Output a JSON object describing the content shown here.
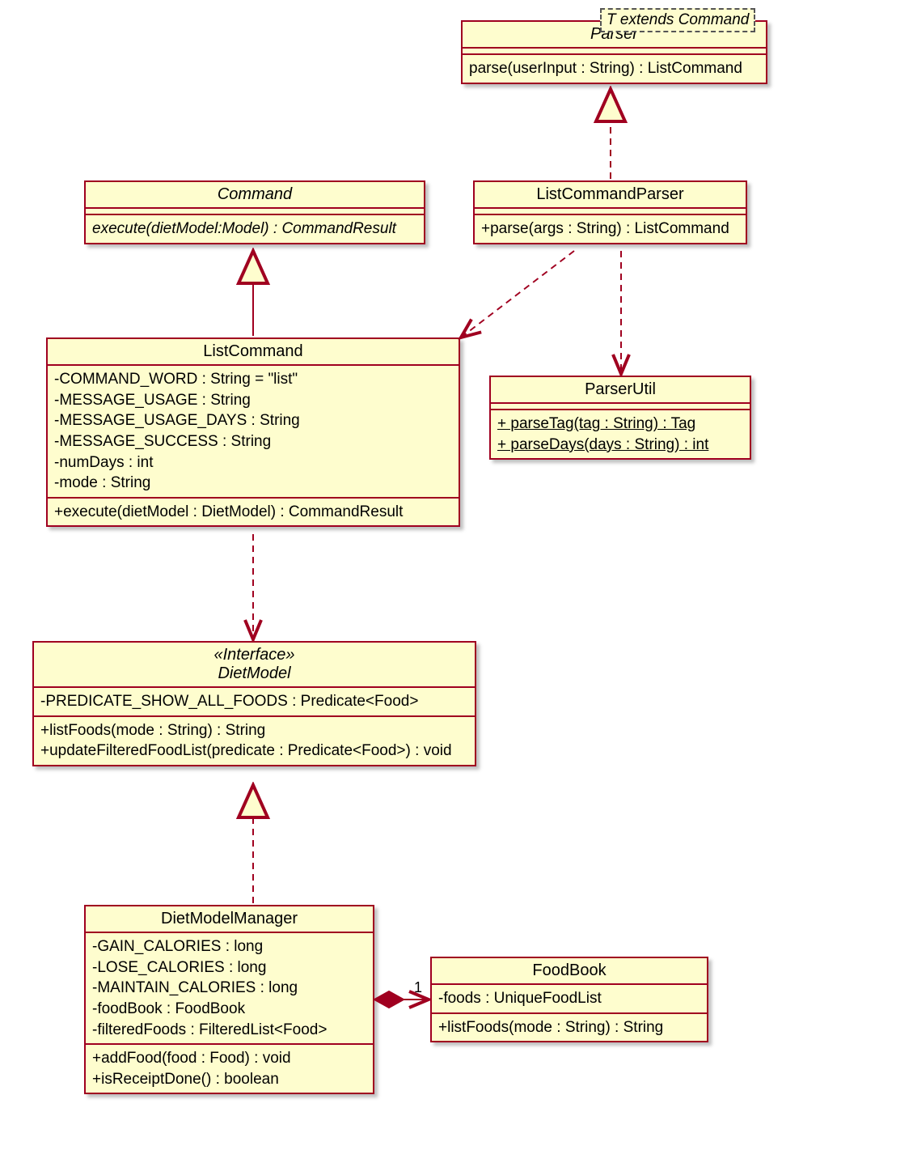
{
  "parser": {
    "title": "Parser",
    "method": "parse(userInput : String) : ListCommand",
    "generic": "T extends Command"
  },
  "command": {
    "title": "Command",
    "method": "execute(dietModel:Model) : CommandResult"
  },
  "listCommandParser": {
    "title": "ListCommandParser",
    "method": "+parse(args : String) : ListCommand"
  },
  "listCommand": {
    "title": "ListCommand",
    "attrs": [
      "-COMMAND_WORD : String = \"list\"",
      "-MESSAGE_USAGE : String",
      "-MESSAGE_USAGE_DAYS : String",
      "-MESSAGE_SUCCESS : String",
      "-numDays : int",
      "-mode : String"
    ],
    "method": "+execute(dietModel : DietModel) : CommandResult"
  },
  "parserUtil": {
    "title": "ParserUtil",
    "m1": "+ parseTag(tag : String) : Tag",
    "m2": "+ parseDays(days : String) : int"
  },
  "dietModel": {
    "stereotype": "«Interface»",
    "title": "DietModel",
    "attr": "-PREDICATE_SHOW_ALL_FOODS : Predicate<Food>",
    "m1": "+listFoods(mode : String) : String",
    "m2": "+updateFilteredFoodList(predicate : Predicate<Food>) : void"
  },
  "dietModelManager": {
    "title": "DietModelManager",
    "attrs": [
      "-GAIN_CALORIES : long",
      "-LOSE_CALORIES : long",
      "-MAINTAIN_CALORIES : long",
      "-foodBook : FoodBook",
      "-filteredFoods : FilteredList<Food>"
    ],
    "m1": "+addFood(food : Food) : void",
    "m2": "+isReceiptDone() : boolean"
  },
  "foodBook": {
    "title": "FoodBook",
    "attr": "-foods : UniqueFoodList",
    "method": "+listFoods(mode : String) : String"
  },
  "assoc": {
    "multiplicity": "1"
  },
  "chart_data": {
    "type": "uml-class-diagram",
    "classes": [
      {
        "name": "Parser",
        "stereotype": null,
        "generic": "T extends Command",
        "abstract": true,
        "attributes": [],
        "operations": [
          "parse(userInput : String) : ListCommand"
        ]
      },
      {
        "name": "Command",
        "abstract": true,
        "attributes": [],
        "operations": [
          "execute(dietModel:Model) : CommandResult"
        ]
      },
      {
        "name": "ListCommandParser",
        "attributes": [],
        "operations": [
          "+parse(args : String) : ListCommand"
        ]
      },
      {
        "name": "ListCommand",
        "attributes": [
          "-COMMAND_WORD : String = \"list\"",
          "-MESSAGE_USAGE : String",
          "-MESSAGE_USAGE_DAYS : String",
          "-MESSAGE_SUCCESS : String",
          "-numDays : int",
          "-mode : String"
        ],
        "operations": [
          "+execute(dietModel : DietModel) : CommandResult"
        ]
      },
      {
        "name": "ParserUtil",
        "attributes": [],
        "operations": [
          "+parseTag(tag : String) : Tag {static}",
          "+parseDays(days : String) : int {static}"
        ]
      },
      {
        "name": "DietModel",
        "stereotype": "interface",
        "attributes": [
          "-PREDICATE_SHOW_ALL_FOODS : Predicate<Food>"
        ],
        "operations": [
          "+listFoods(mode : String) : String",
          "+updateFilteredFoodList(predicate : Predicate<Food>) : void"
        ]
      },
      {
        "name": "DietModelManager",
        "attributes": [
          "-GAIN_CALORIES : long",
          "-LOSE_CALORIES : long",
          "-MAINTAIN_CALORIES : long",
          "-foodBook : FoodBook",
          "-filteredFoods : FilteredList<Food>"
        ],
        "operations": [
          "+addFood(food : Food) : void",
          "+isReceiptDone() : boolean"
        ]
      },
      {
        "name": "FoodBook",
        "attributes": [
          "-foods : UniqueFoodList"
        ],
        "operations": [
          "+listFoods(mode : String) : String"
        ]
      }
    ],
    "relationships": [
      {
        "from": "ListCommandParser",
        "to": "Parser",
        "type": "realization"
      },
      {
        "from": "ListCommand",
        "to": "Command",
        "type": "generalization"
      },
      {
        "from": "ListCommandParser",
        "to": "ListCommand",
        "type": "dependency"
      },
      {
        "from": "ListCommandParser",
        "to": "ParserUtil",
        "type": "dependency"
      },
      {
        "from": "ListCommand",
        "to": "DietModel",
        "type": "dependency"
      },
      {
        "from": "DietModelManager",
        "to": "DietModel",
        "type": "realization"
      },
      {
        "from": "DietModelManager",
        "to": "FoodBook",
        "type": "composition",
        "multiplicity_to": "1"
      }
    ]
  }
}
